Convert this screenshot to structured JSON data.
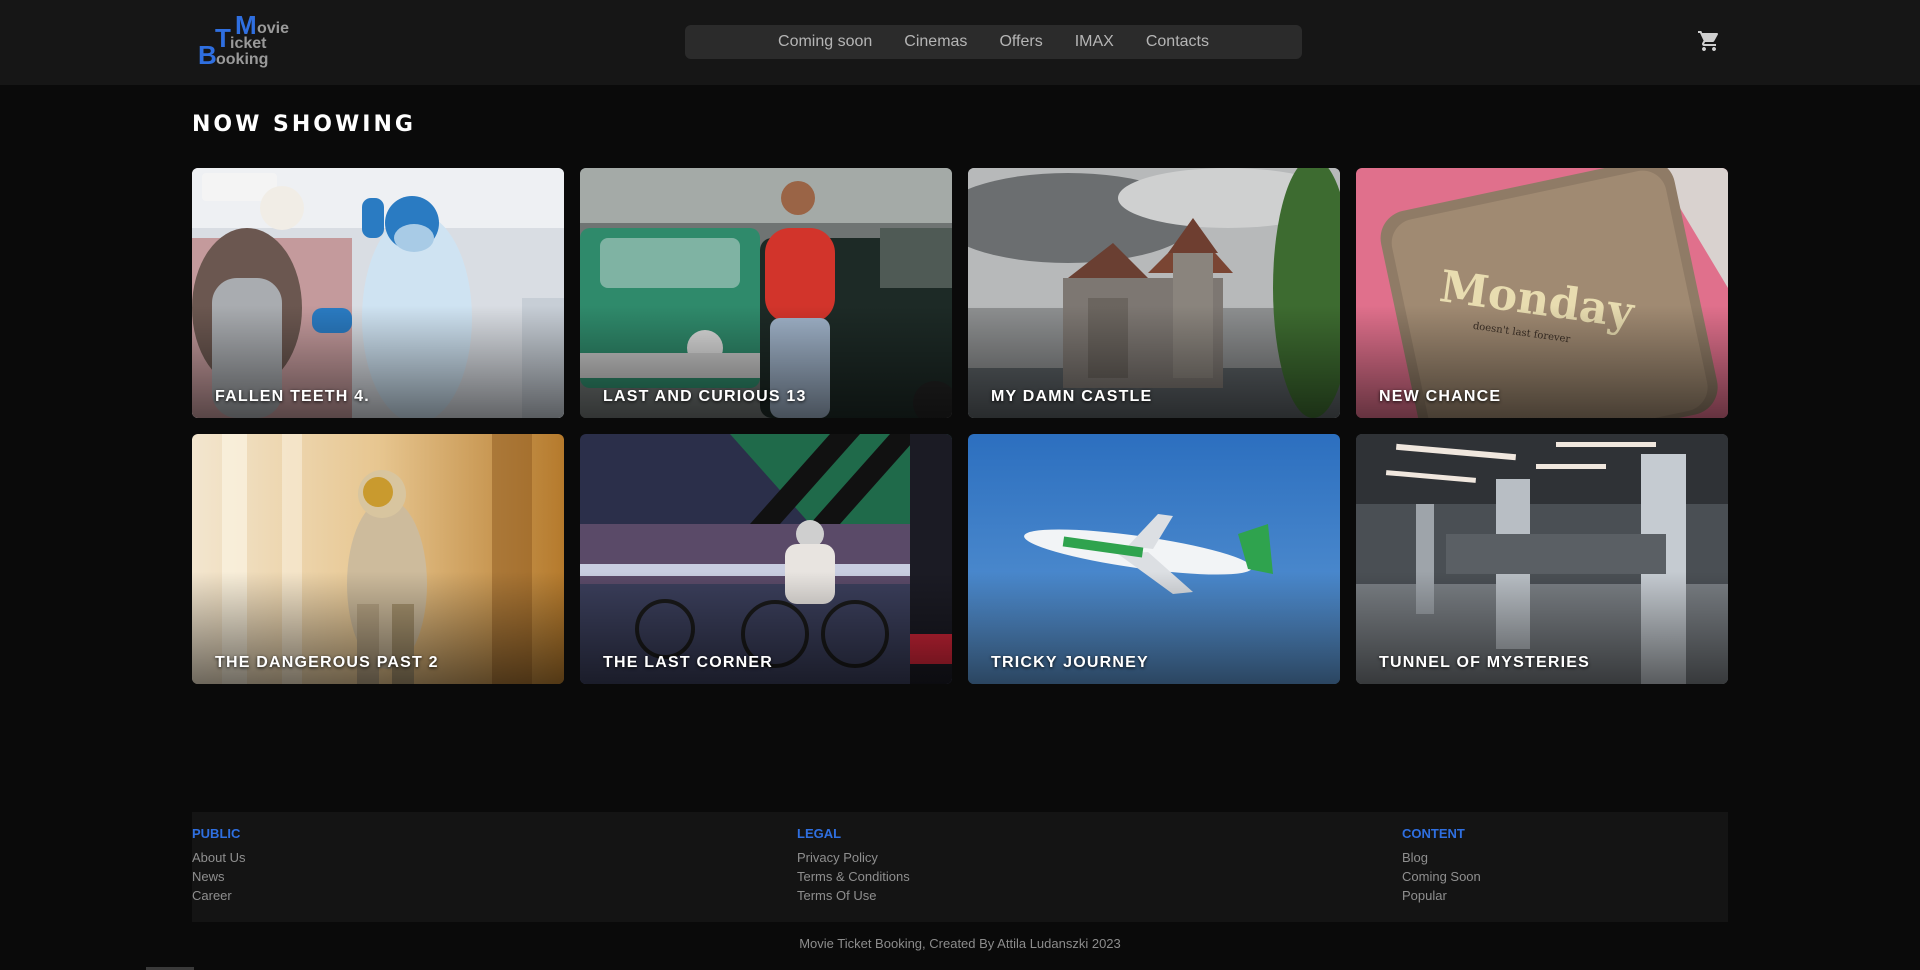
{
  "logo": {
    "m": "M",
    "ovie": "ovie",
    "t": "T",
    "icket": "icket",
    "b": "B",
    "ooking": "ooking"
  },
  "nav": {
    "items": [
      {
        "label": "Coming soon"
      },
      {
        "label": "Cinemas"
      },
      {
        "label": "Offers"
      },
      {
        "label": "IMAX"
      },
      {
        "label": "Contacts"
      }
    ]
  },
  "header": {
    "cart_icon": "shopping-cart-icon"
  },
  "main": {
    "title": "NOW SHOWING",
    "movies": [
      {
        "title": "FALLEN TEETH 4."
      },
      {
        "title": "LAST AND CURIOUS 13"
      },
      {
        "title": "MY DAMN CASTLE"
      },
      {
        "title": "NEW CHANCE"
      },
      {
        "title": "THE DANGEROUS PAST 2"
      },
      {
        "title": "THE LAST CORNER"
      },
      {
        "title": "TRICKY JOURNEY"
      },
      {
        "title": "TUNNEL OF MYSTERIES"
      }
    ]
  },
  "footer": {
    "columns": [
      {
        "heading": "PUBLIC",
        "links": [
          "About Us",
          "News",
          "Career"
        ]
      },
      {
        "heading": "LEGAL",
        "links": [
          "Privacy Policy",
          "Terms & Conditions",
          "Terms Of Use"
        ]
      },
      {
        "heading": "CONTENT",
        "links": [
          "Blog",
          "Coming Soon",
          "Popular"
        ]
      }
    ],
    "copyright": "Movie Ticket Booking, Created By Attila Ludanszki 2023"
  },
  "colors": {
    "accent": "#2f6fe0",
    "background": "#0a0a0a",
    "header": "#161616"
  }
}
